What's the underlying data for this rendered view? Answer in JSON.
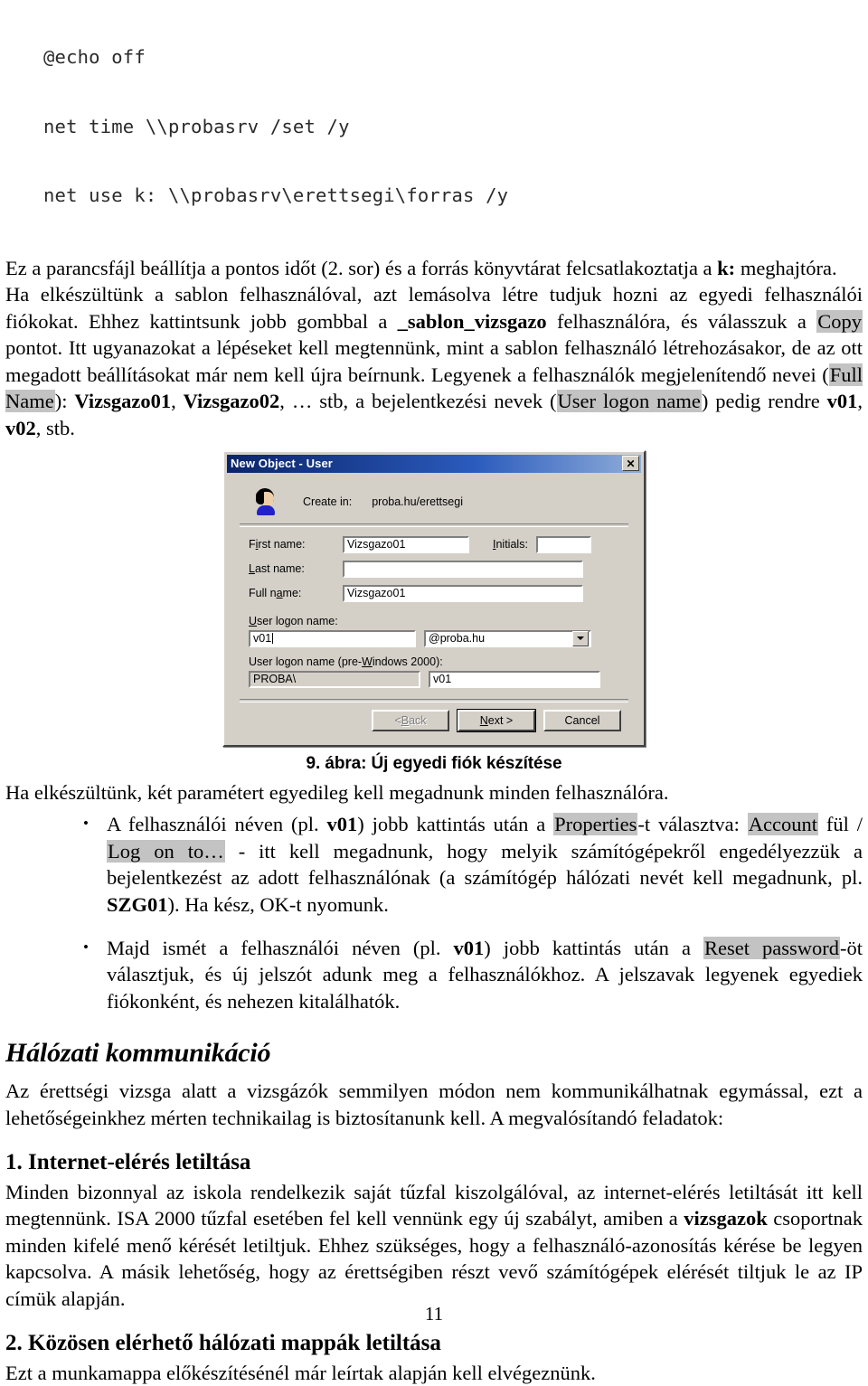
{
  "code_block": {
    "lines": [
      "@echo off",
      "net time \\\\probasrv /set /y",
      "net use k: \\\\probasrv\\erettsegi\\forras /y"
    ]
  },
  "paragraphs": {
    "p1_a": "Ez a parancsfájl beállítja a pontos időt (2. sor) és a forrás könyvtárat felcsatlakoztatja a ",
    "p1_bold": "k:",
    "p1_b": " meghajtóra.",
    "p2_a": "Ha elkészültünk a sablon felhasználóval, azt lemásolva létre tudjuk hozni az egyedi felhasználói fiókokat. Ehhez kattintsunk jobb gombbal a ",
    "p2_bold1": "_sablon_vizsgazo",
    "p2_b": " felhasználóra, és válasszuk a ",
    "p2_hl1": "Copy",
    "p2_c": " pontot. Itt ugyanazokat a lépéseket kell megtennünk, mint a sablon felhasználó létrehozásakor, de az ott megadott beállításokat már nem kell újra beírnunk. Legyenek a felhasználók megjelenítendő nevei (",
    "p2_hl2": "Full Name",
    "p2_d": "): ",
    "p2_bold2": "Vizsgazo01",
    "p2_e": ", ",
    "p2_bold3": "Vizsgazo02",
    "p2_f": ", … stb, a bejelentkezési nevek (",
    "p2_hl3": "User logon name",
    "p2_g": ") pedig rendre ",
    "p2_bold4": "v01",
    "p2_h": ", ",
    "p2_bold5": "v02",
    "p2_i": ", stb."
  },
  "dialog": {
    "title": "New Object - User",
    "close_label": "✕",
    "create_in_label": "Create in:",
    "create_in_value": "proba.hu/erettsegi",
    "fields": {
      "first_name_label_pre": "F",
      "first_name_label_mnemonic": "i",
      "first_name_label_post": "rst name:",
      "first_name_value": "Vizsgazo01",
      "initials_label_pre": "",
      "initials_label_mnemonic": "I",
      "initials_label_post": "nitials:",
      "initials_value": "",
      "last_name_label_pre": "",
      "last_name_label_mnemonic": "L",
      "last_name_label_post": "ast name:",
      "last_name_value": "",
      "full_name_label_pre": "Full n",
      "full_name_label_mnemonic": "a",
      "full_name_label_post": "me:",
      "full_name_value": "Vizsgazo01",
      "user_logon_label_pre": "",
      "user_logon_label_mnemonic": "U",
      "user_logon_label_post": "ser logon name:",
      "user_logon_value": "v01",
      "domain_suffix": "@proba.hu",
      "pre_logon_label_pre": "User logon name (pre-",
      "pre_logon_label_mnemonic": "W",
      "pre_logon_label_post": "indows 2000):",
      "pre_domain_value": "PROBA\\",
      "pre_logon_value": "v01"
    },
    "buttons": {
      "back_pre": "< ",
      "back_mnemonic": "B",
      "back_post": "ack",
      "next_pre": "",
      "next_mnemonic": "N",
      "next_post": "ext >",
      "cancel": "Cancel"
    }
  },
  "figure_caption": "9. ábra: Új egyedi fiók készítése",
  "after_figure": {
    "intro": "Ha elkészültünk, két paramétert egyedileg kell megadnunk minden felhasználóra.",
    "bullet1_a": "A felhasználói néven (pl. ",
    "bullet1_bold1": "v01",
    "bullet1_b": ") jobb kattintás után a ",
    "bullet1_hl1": "Properties",
    "bullet1_c": "-t választva: ",
    "bullet1_hl2": "Account",
    "bullet1_d": " fül / ",
    "bullet1_hl3": "Log on to…",
    "bullet1_e": " - itt kell megadnunk, hogy melyik számítógépekről engedélyezzük a bejelentkezést az adott felhasználónak (a számítógép hálózati nevét kell megadnunk, pl. ",
    "bullet1_bold2": "SZG01",
    "bullet1_f": "). Ha kész, OK-t nyomunk.",
    "bullet2_a": "Majd ismét a felhasználói néven (pl. ",
    "bullet2_bold1": "v01",
    "bullet2_b": ") jobb kattintás után a ",
    "bullet2_hl1": "Reset password",
    "bullet2_c": "-öt választjuk, és új jelszót adunk meg a felhasználókhoz. A jelszavak legyenek egyediek fiókonként, és nehezen kitalálhatók."
  },
  "section": {
    "heading": "Hálózati kommunikáció",
    "intro": "Az érettségi vizsga alatt a vizsgázók semmilyen módon nem kommunikálhatnak egymással, ezt a lehetőségeinkhez mérten technikailag is biztosítanunk kell. A megvalósítandó feladatok:",
    "sub1_heading": "1. Internet-elérés letiltása",
    "sub1_a": "Minden bizonnyal az iskola rendelkezik saját tűzfal kiszolgálóval, az internet-elérés letiltását itt kell megtennünk. ISA 2000 tűzfal esetében fel kell vennünk egy új szabályt, amiben a ",
    "sub1_bold": "vizsgazok",
    "sub1_b": " csoportnak minden kifelé menő kérését letiltjuk. Ehhez szükséges, hogy a felhasználó-azonosítás kérése be legyen kapcsolva. A másik lehetőség, hogy az érettségiben részt vevő számítógépek elérését tiltjuk le az IP címük alapján.",
    "sub2_heading": "2. Közösen elérhető hálózati mappák letiltása",
    "sub2_text": "Ezt a munkamappa előkészítésénél már leírtak alapján kell elvégeznünk."
  },
  "page_number": "11"
}
